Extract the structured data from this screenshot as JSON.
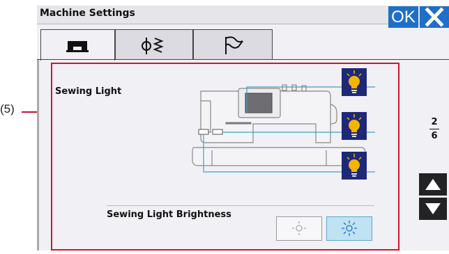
{
  "callout": {
    "label": "(5)"
  },
  "title_bar": {
    "title": "Machine Settings",
    "ok_label": "OK"
  },
  "tabs": [
    {
      "name": "machine",
      "icon": "sewing-machine-icon",
      "active": true
    },
    {
      "name": "bobbin",
      "icon": "bobbin-thread-icon",
      "active": false
    },
    {
      "name": "flag",
      "icon": "flag-icon",
      "active": false
    }
  ],
  "sewing_light": {
    "label": "Sewing Light",
    "lights": [
      {
        "icon": "light-bulb-icon",
        "position": "upper"
      },
      {
        "icon": "light-bulb-icon",
        "position": "middle"
      },
      {
        "icon": "light-bulb-icon",
        "position": "lower"
      }
    ]
  },
  "brightness": {
    "label": "Sewing Light Brightness",
    "options": [
      {
        "icon": "low-brightness-icon",
        "selected": false
      },
      {
        "icon": "high-brightness-icon",
        "selected": true
      }
    ]
  },
  "pager": {
    "current": "2",
    "total": "6"
  },
  "colors": {
    "accent": "#1f6fc6",
    "highlight": "#d8122a",
    "selected": "#bfe3f2",
    "bulb_bg": "#1e2878",
    "bulb": "#f4b400"
  }
}
